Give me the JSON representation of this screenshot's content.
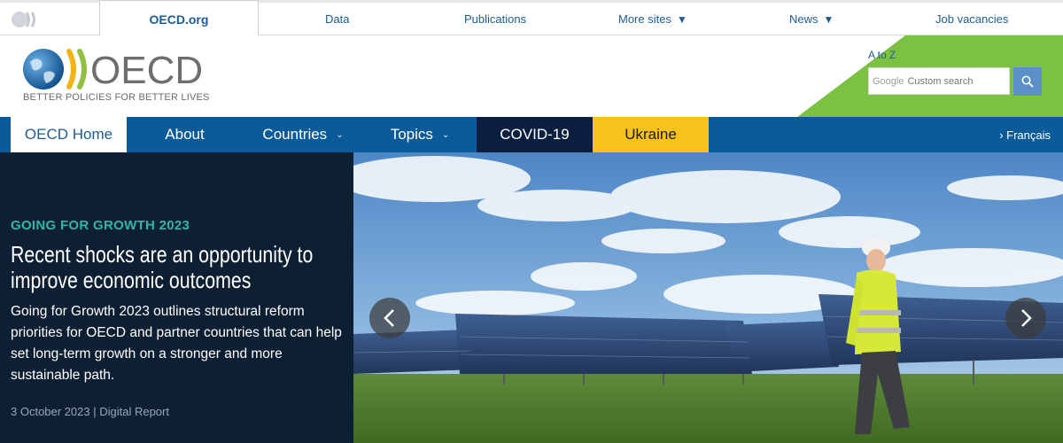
{
  "topbar": {
    "active_tab": "OECD.org",
    "links": [
      {
        "label": "Data",
        "dropdown": false
      },
      {
        "label": "Publications",
        "dropdown": false
      },
      {
        "label": "More sites",
        "dropdown": true
      },
      {
        "label": "News",
        "dropdown": true
      },
      {
        "label": "Job vacancies",
        "dropdown": false
      }
    ]
  },
  "header": {
    "logo_text": "OECD",
    "tagline": "BETTER POLICIES FOR BETTER LIVES",
    "atoz": "A to Z",
    "search_brand": "Google",
    "search_placeholder": "Custom search"
  },
  "nav": {
    "home": "OECD Home",
    "about": "About",
    "countries": "Countries",
    "topics": "Topics",
    "covid": "COVID-19",
    "ukraine": "Ukraine",
    "francais": "› Français"
  },
  "hero": {
    "kicker": "GOING FOR GROWTH 2023",
    "headline": "Recent shocks are an opportunity to improve economic outcomes",
    "description": "Going for Growth 2023 outlines structural reform priorities for OECD and partner countries that can help set long-term growth on a stronger and more sustainable path.",
    "meta": "3 October 2023 | Digital Report"
  },
  "colors": {
    "brand_blue": "#0b5b9a",
    "link_blue": "#1d5b95",
    "green": "#7cc242",
    "dark_navy": "#0d1f33",
    "covid_bg": "#0a1f3f",
    "ukraine_bg": "#f7c21b",
    "kicker": "#2fb6a7"
  },
  "icons": [
    "oecd-mini-logo-icon",
    "oecd-globe-logo-icon",
    "search-icon",
    "chevron-left-icon",
    "chevron-right-icon",
    "caret-down-icon"
  ]
}
